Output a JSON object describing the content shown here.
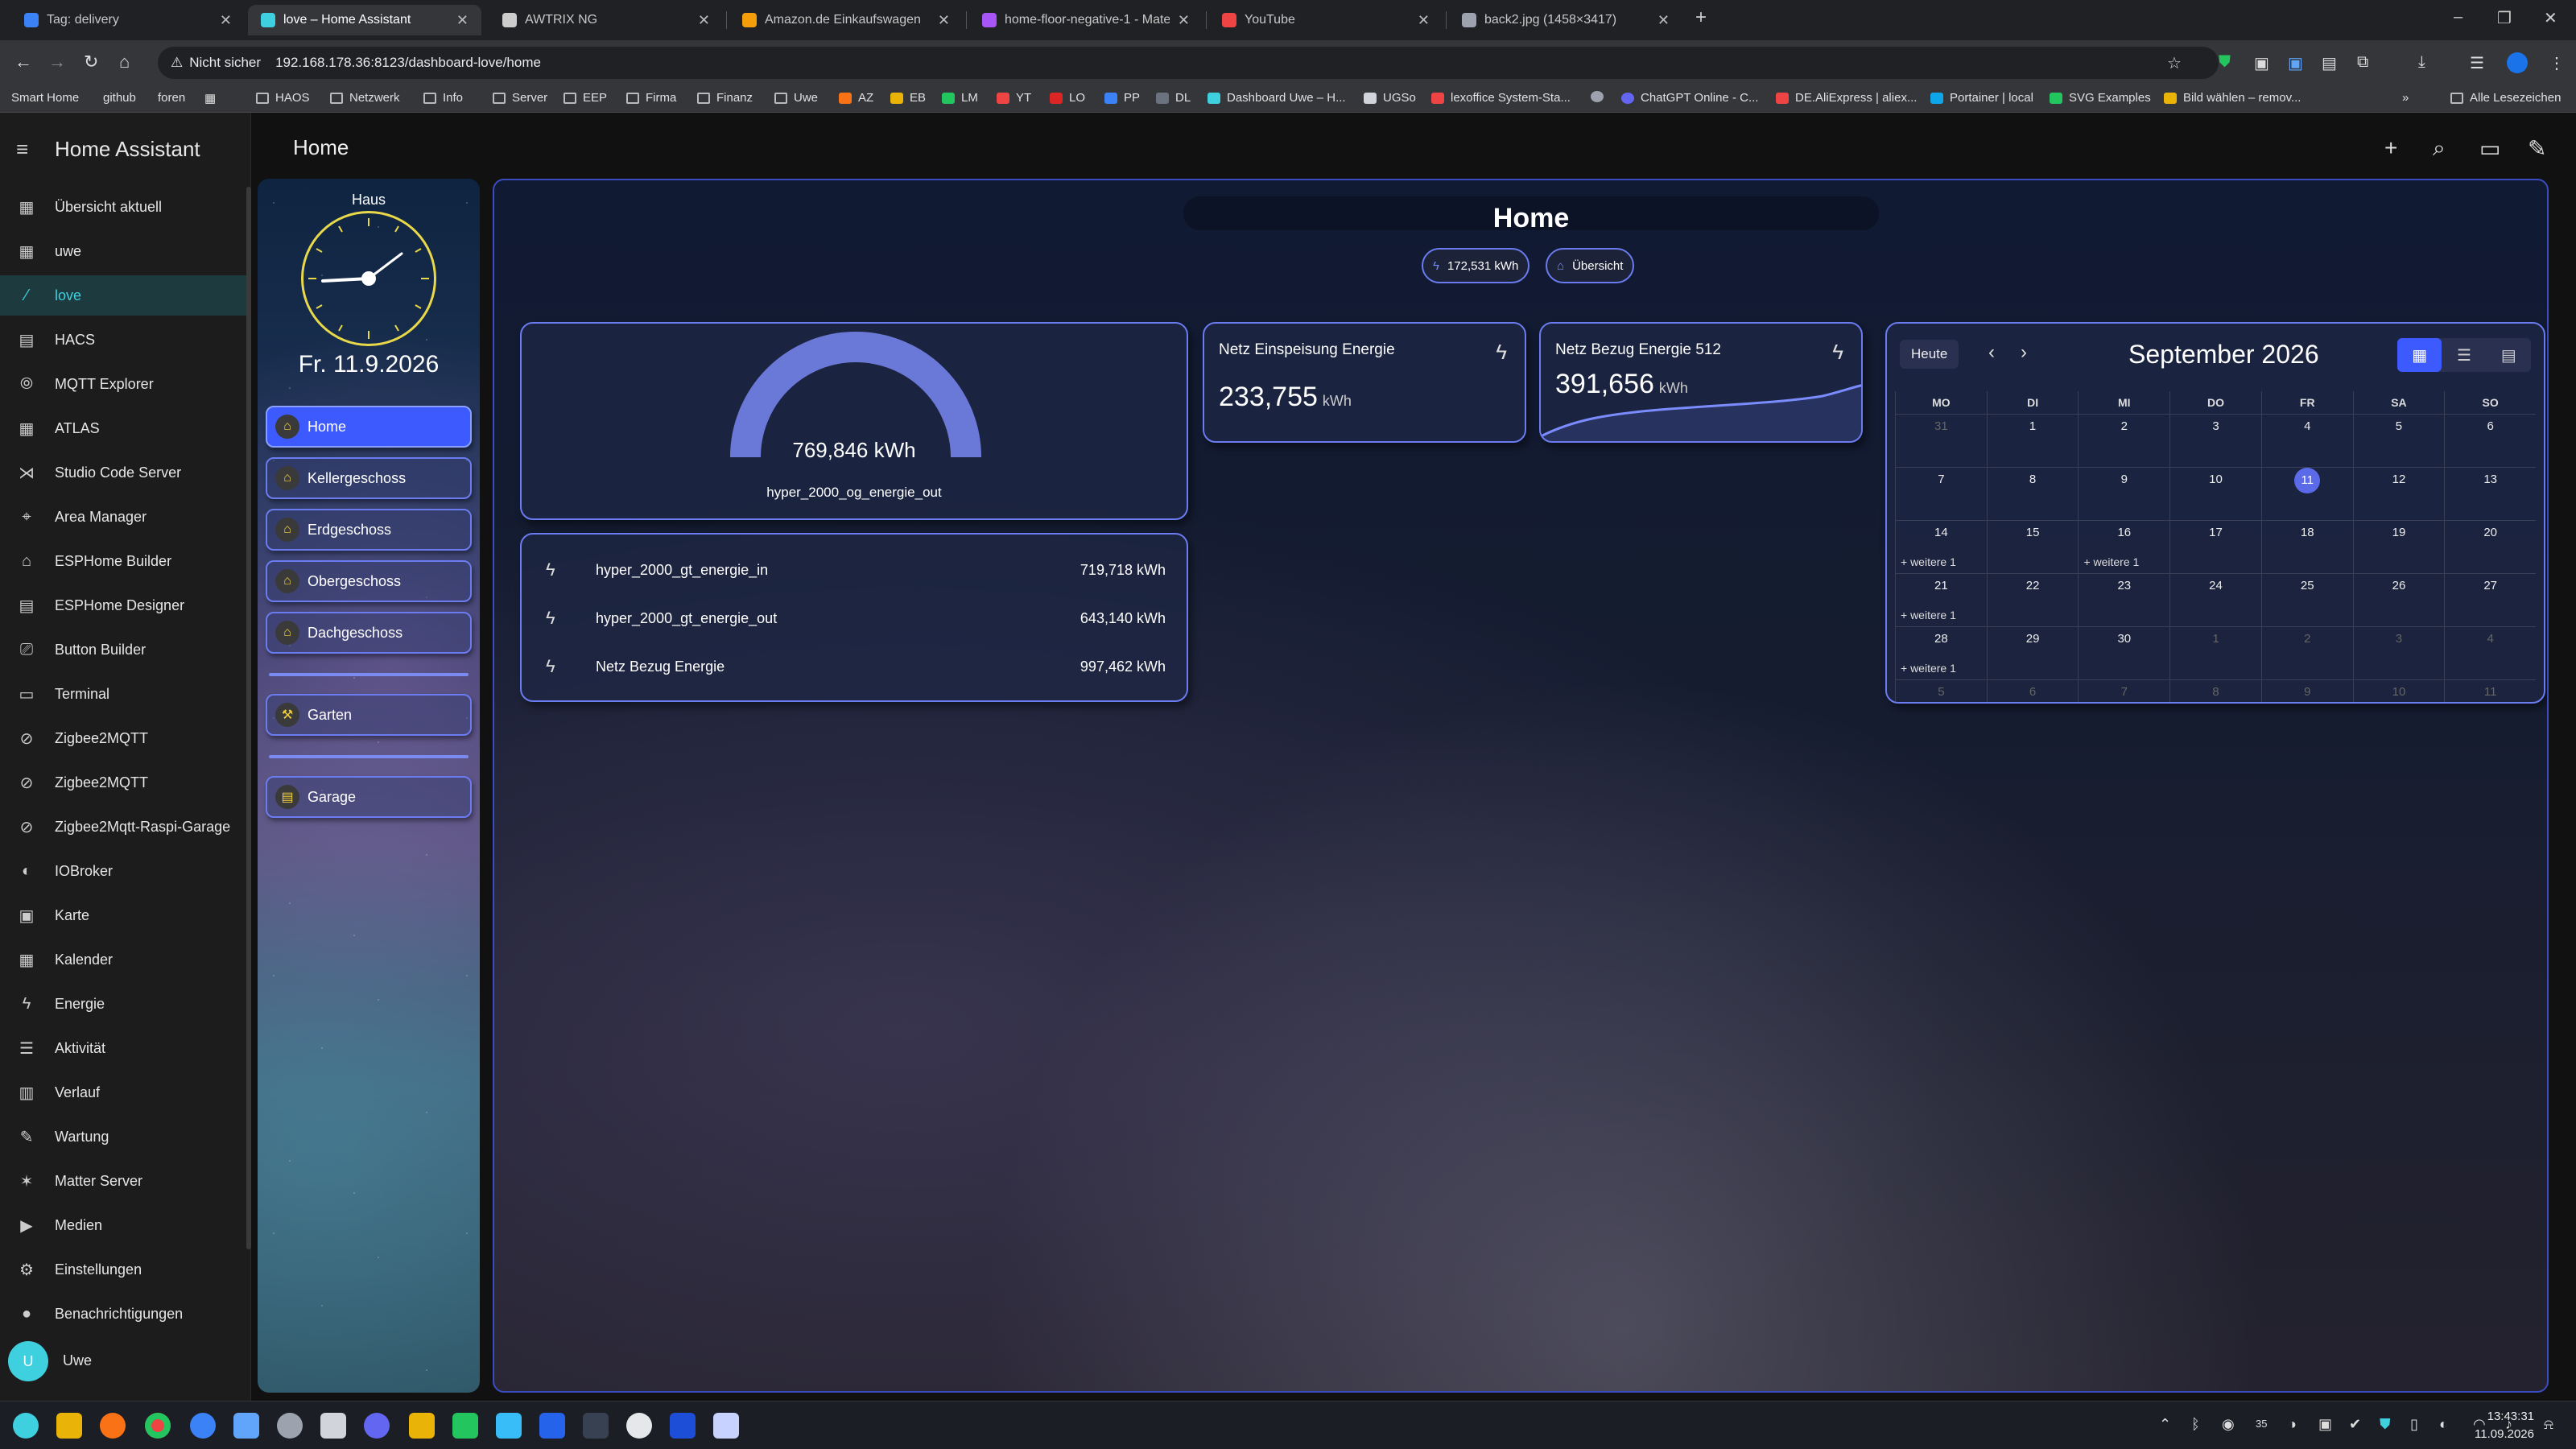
{
  "browser": {
    "tabs": [
      {
        "title": "Tag: delivery",
        "color": "#3b82f6"
      },
      {
        "title": "love – Home Assistant",
        "color": "#3fd0e0"
      },
      {
        "title": "AWTRIX NG",
        "color": "#cccccc"
      },
      {
        "title": "Amazon.de Einkaufswagen",
        "color": "#f59e0b"
      },
      {
        "title": "home-floor-negative-1 - Mater",
        "color": "#a855f7"
      },
      {
        "title": "YouTube",
        "color": "#ef4444"
      },
      {
        "title": "back2.jpg (1458×3417)",
        "color": "#9ca3af"
      }
    ],
    "security_label": "Nicht sicher",
    "url": "192.168.178.36:8123/dashboard-love/home",
    "bookmarks": [
      "Smart Home",
      "github",
      "foren",
      "HAOS",
      "Netzwerk",
      "Info",
      "Server",
      "EEP",
      "Firma",
      "Finanz",
      "Uwe",
      "AZ",
      "EB",
      "LM",
      "YT",
      "LO",
      "PP",
      "DL",
      "Dashboard Uwe – H...",
      "UGSo",
      "lexoffice System-Sta...",
      "ChatGPT Online - C...",
      "DE.AliExpress | aliex...",
      "Portainer | local",
      "SVG Examples",
      "Bild wählen – remov...",
      "Alle Lesezeichen"
    ]
  },
  "ha": {
    "app_title": "Home Assistant",
    "page_title": "Home",
    "sidebar": [
      {
        "label": "Übersicht aktuell",
        "icon": "▦"
      },
      {
        "label": "uwe",
        "icon": "▦"
      },
      {
        "label": "love",
        "icon": "⁄"
      },
      {
        "label": "HACS",
        "icon": "▤"
      },
      {
        "label": "MQTT Explorer",
        "icon": "⦾"
      },
      {
        "label": "ATLAS",
        "icon": "▦"
      },
      {
        "label": "Studio Code Server",
        "icon": "⋊"
      },
      {
        "label": "Area Manager",
        "icon": "⌖"
      },
      {
        "label": "ESPHome Builder",
        "icon": "⌂"
      },
      {
        "label": "ESPHome Designer",
        "icon": "▤"
      },
      {
        "label": "Button Builder",
        "icon": "⎚"
      },
      {
        "label": "Terminal",
        "icon": "▭"
      },
      {
        "label": "Zigbee2MQTT",
        "icon": "⊘"
      },
      {
        "label": "Zigbee2MQTT",
        "icon": "⊘"
      },
      {
        "label": "Zigbee2Mqtt-Raspi-Garage",
        "icon": "⊘"
      },
      {
        "label": "IOBroker",
        "icon": "◐"
      },
      {
        "label": "Karte",
        "icon": "▣"
      },
      {
        "label": "Kalender",
        "icon": "▦"
      },
      {
        "label": "Energie",
        "icon": "ϟ"
      },
      {
        "label": "Aktivität",
        "icon": "☰"
      },
      {
        "label": "Verlauf",
        "icon": "▥"
      },
      {
        "label": "Wartung",
        "icon": "✎"
      },
      {
        "label": "Matter Server",
        "icon": "✶"
      },
      {
        "label": "Medien",
        "icon": "▶"
      },
      {
        "label": "Einstellungen",
        "icon": "⚙"
      },
      {
        "label": "Benachrichtigungen",
        "icon": "●"
      }
    ],
    "user_initial": "U",
    "user_name": "Uwe"
  },
  "panel": {
    "haus_label": "Haus",
    "date": "Fr. 11.9.2026",
    "rooms": [
      {
        "label": "Home",
        "active": true
      },
      {
        "label": "Kellergeschoss",
        "active": false
      },
      {
        "label": "Erdgeschoss",
        "active": false
      },
      {
        "label": "Obergeschoss",
        "active": false
      },
      {
        "label": "Dachgeschoss",
        "active": false
      },
      {
        "label": "Garten",
        "active": false
      },
      {
        "label": "Garage",
        "active": false
      }
    ]
  },
  "dashboard": {
    "title": "Home",
    "chips": [
      {
        "label": "172,531 kWh",
        "icon": "ϟ"
      },
      {
        "label": "Übersicht",
        "icon": "⌂"
      }
    ],
    "gauge": {
      "value_text": "769,846 kWh",
      "entity": "hyper_2000_og_energie_out",
      "fraction": 1.0
    },
    "energy_list": [
      {
        "name": "hyper_2000_gt_energie_in",
        "value": "719,718 kWh"
      },
      {
        "name": "hyper_2000_gt_energie_out",
        "value": "643,140 kWh"
      },
      {
        "name": "Netz Bezug Energie",
        "value": "997,462 kWh"
      }
    ],
    "stat1": {
      "title": "Netz Einspeisung Energie",
      "value": "233,755",
      "unit": "kWh"
    },
    "stat2": {
      "title": "Netz Bezug Energie 512",
      "value": "391,656",
      "unit": "kWh"
    },
    "calendar": {
      "today_label": "Heute",
      "month_title": "September 2026",
      "weekdays": [
        "MO",
        "DI",
        "MI",
        "DO",
        "FR",
        "SA",
        "SO"
      ],
      "weeks": [
        [
          {
            "d": "31",
            "o": true
          },
          {
            "d": "1"
          },
          {
            "d": "2"
          },
          {
            "d": "3"
          },
          {
            "d": "4"
          },
          {
            "d": "5"
          },
          {
            "d": "6"
          }
        ],
        [
          {
            "d": "7"
          },
          {
            "d": "8"
          },
          {
            "d": "9"
          },
          {
            "d": "10"
          },
          {
            "d": "11",
            "today": true
          },
          {
            "d": "12"
          },
          {
            "d": "13"
          }
        ],
        [
          {
            "d": "14",
            "more": "+ weitere 1"
          },
          {
            "d": "15"
          },
          {
            "d": "16",
            "more": "+ weitere 1"
          },
          {
            "d": "17"
          },
          {
            "d": "18"
          },
          {
            "d": "19"
          },
          {
            "d": "20"
          }
        ],
        [
          {
            "d": "21",
            "more": "+ weitere 1"
          },
          {
            "d": "22"
          },
          {
            "d": "23"
          },
          {
            "d": "24"
          },
          {
            "d": "25"
          },
          {
            "d": "26"
          },
          {
            "d": "27"
          }
        ],
        [
          {
            "d": "28",
            "more": "+ weitere 1"
          },
          {
            "d": "29"
          },
          {
            "d": "30"
          },
          {
            "d": "1",
            "o": true
          },
          {
            "d": "2",
            "o": true
          },
          {
            "d": "3",
            "o": true
          },
          {
            "d": "4",
            "o": true
          }
        ],
        [
          {
            "d": "5",
            "o": true
          },
          {
            "d": "6",
            "o": true
          },
          {
            "d": "7",
            "o": true
          },
          {
            "d": "8",
            "o": true
          },
          {
            "d": "9",
            "o": true
          },
          {
            "d": "10",
            "o": true
          },
          {
            "d": "11",
            "o": true
          }
        ]
      ]
    }
  },
  "taskbar": {
    "time": "13:43:31",
    "date": "11.09.2026",
    "tray_number": "35"
  },
  "colors": {
    "accent": "#3d5afe",
    "ha_cyan": "#3fd0e0",
    "card_border": "#6a7cf0",
    "gauge": "#6a78d8"
  }
}
